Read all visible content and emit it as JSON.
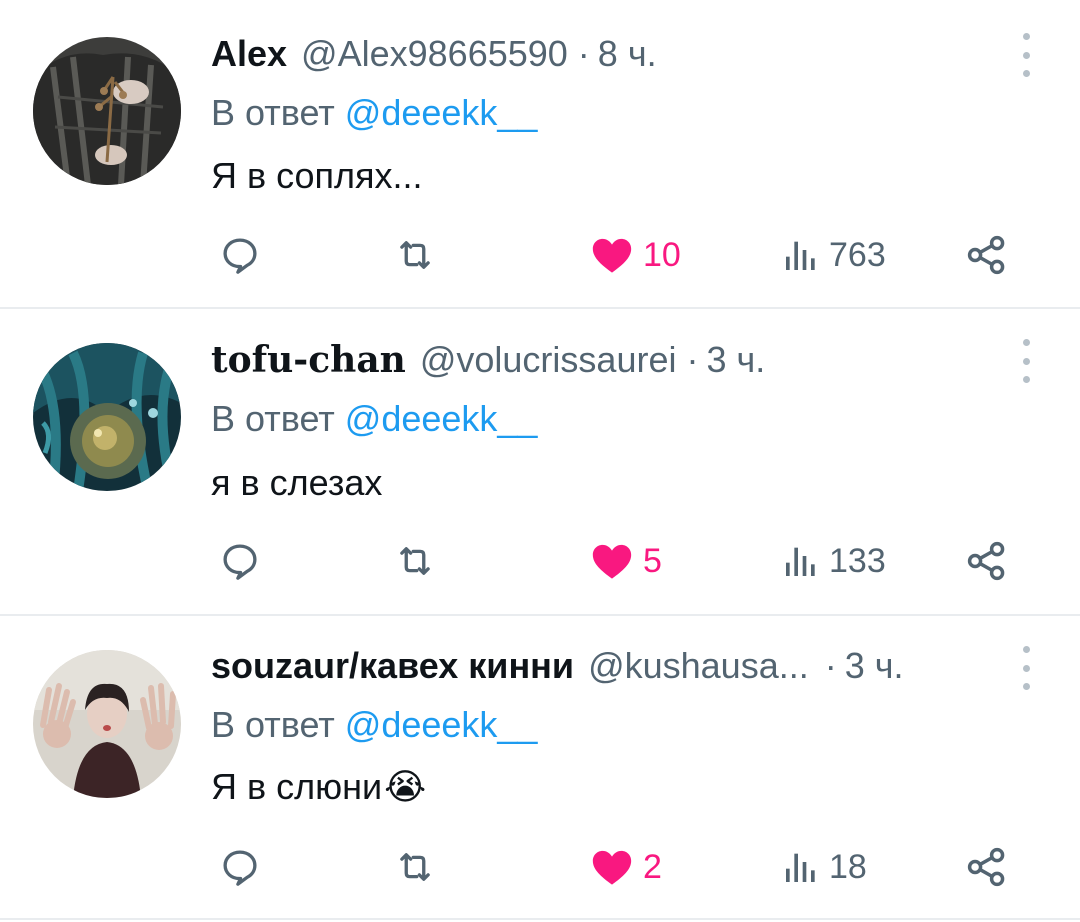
{
  "tweets": [
    {
      "name": "Alex",
      "handle": "@Alex98665590",
      "separator": "·",
      "time": "8 ч.",
      "reply_prefix": "В ответ ",
      "reply_to": "@deeekk__",
      "text": "Я в соплях...",
      "likes": "10",
      "views": "763"
    },
    {
      "name": "tofu-chan",
      "handle": "@volucrissaurei",
      "separator": "·",
      "time": "3 ч.",
      "reply_prefix": "В ответ ",
      "reply_to": "@deeekk__",
      "text": "я в слезах",
      "likes": "5",
      "views": "133"
    },
    {
      "name": "souzaur/кавех кинни",
      "handle": "@kushausa...",
      "separator": "·",
      "time": "3 ч.",
      "reply_prefix": "В ответ ",
      "reply_to": "@deeekk__",
      "text": "Я в слюни",
      "emoji": "😭",
      "likes": "2",
      "views": "18"
    }
  ],
  "icons": {
    "reply": "speech-bubble-icon",
    "retweet": "retweet-arrows-icon",
    "like": "heart-filled-icon",
    "views": "bar-chart-icon",
    "share": "share-nodes-icon",
    "more": "vertical-dots-icon"
  },
  "colors": {
    "like_active": "#f91880",
    "mention": "#1d9bf0",
    "secondary_text": "#536471"
  }
}
